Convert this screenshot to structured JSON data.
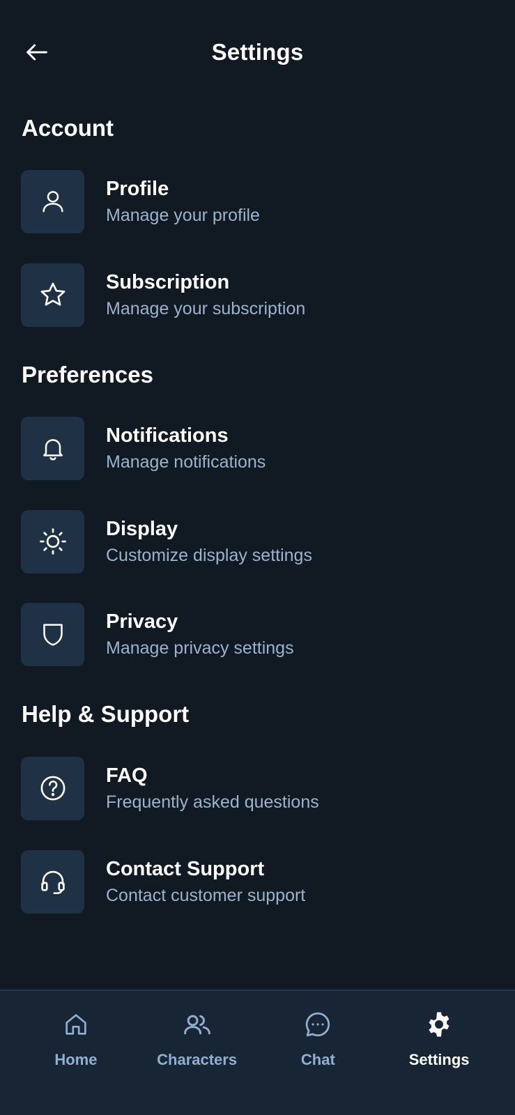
{
  "header": {
    "title": "Settings"
  },
  "sections": [
    {
      "title": "Account"
    },
    {
      "title": "Preferences"
    },
    {
      "title": "Help & Support"
    }
  ],
  "items": [
    {
      "title": "Profile",
      "subtitle": "Manage your profile",
      "icon": "user-icon"
    },
    {
      "title": "Subscription",
      "subtitle": "Manage your subscription",
      "icon": "star-icon"
    },
    {
      "title": "Notifications",
      "subtitle": "Manage notifications",
      "icon": "bell-icon"
    },
    {
      "title": "Display",
      "subtitle": "Customize display settings",
      "icon": "sun-icon"
    },
    {
      "title": "Privacy",
      "subtitle": "Manage privacy settings",
      "icon": "shield-icon"
    },
    {
      "title": "FAQ",
      "subtitle": "Frequently asked questions",
      "icon": "question-icon"
    },
    {
      "title": "Contact Support",
      "subtitle": "Contact customer support",
      "icon": "headset-icon"
    }
  ],
  "nav": [
    {
      "label": "Home",
      "icon": "home-icon",
      "active": false
    },
    {
      "label": "Characters",
      "icon": "users-icon",
      "active": false
    },
    {
      "label": "Chat",
      "icon": "chat-bubble-icon",
      "active": false
    },
    {
      "label": "Settings",
      "icon": "gear-icon",
      "active": true
    }
  ],
  "colors": {
    "background": "#111a23",
    "icon_box": "#1e3145",
    "subtitle": "#9bb3cc",
    "nav_background": "#182534",
    "nav_inactive": "#8fb0cf",
    "nav_active": "#ffffff"
  }
}
